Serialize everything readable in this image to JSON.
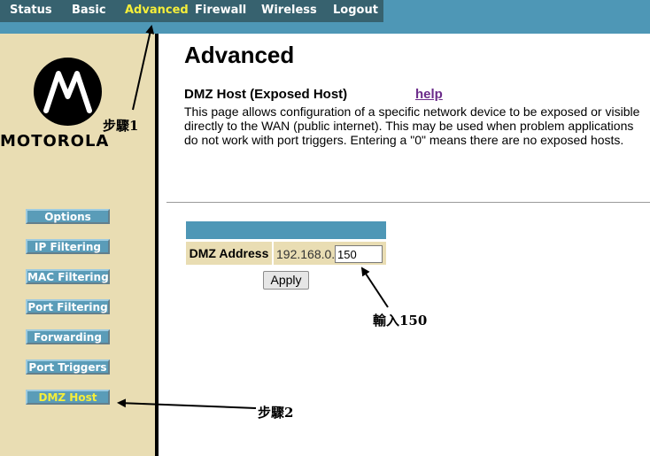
{
  "nav": {
    "items": [
      "Status",
      "Basic",
      "Advanced",
      "Firewall",
      "Wireless",
      "Logout"
    ],
    "active": "Advanced"
  },
  "logo": {
    "text": "MOTOROLA"
  },
  "sidebar": {
    "buttons": [
      "Options",
      "IP Filtering",
      "MAC Filtering",
      "Port Filtering",
      "Forwarding",
      "Port Triggers",
      "DMZ Host"
    ],
    "active": "DMZ Host"
  },
  "main": {
    "title": "Advanced",
    "section_title": "DMZ Host (Exposed Host)",
    "help_label": "help",
    "description": "This page allows configuration of a specific network device to be exposed or visible directly to the WAN (public internet).  This may be used when problem applications do not work with port triggers.  Entering a \"0\" means there are no exposed hosts.",
    "dmz": {
      "label": "DMZ Address",
      "ip_prefix": "192.168.0.",
      "value": "150"
    },
    "apply_label": "Apply"
  },
  "annotations": {
    "step1": "步驟1",
    "step2": "步驟2",
    "input_hint": "輸入150"
  },
  "colors": {
    "topbar": "#4e97b6",
    "nav_bg": "#37626f",
    "sidebar_bg": "#e9ddb3",
    "active_text": "#f5ee3a",
    "button_bg": "#5a9cb8",
    "link": "#6b2b8a"
  }
}
